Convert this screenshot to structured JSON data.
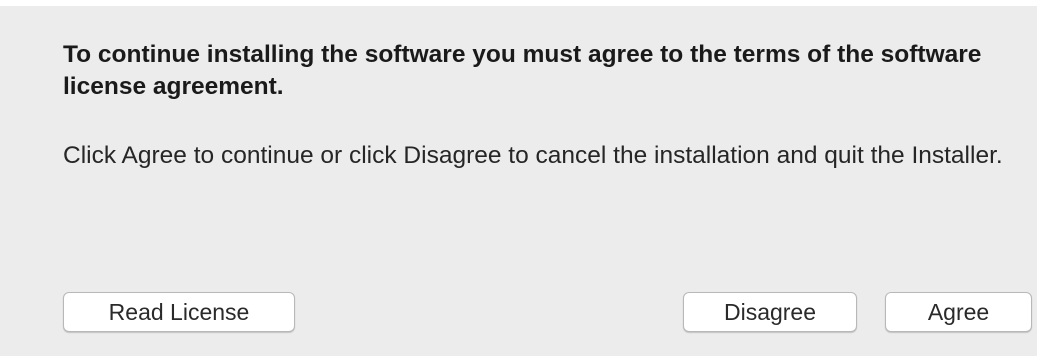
{
  "dialog": {
    "heading": "To continue installing the software you must agree to the terms of the software license agreement.",
    "message": "Click Agree to continue or click Disagree to cancel the installation and quit the Installer."
  },
  "buttons": {
    "read_license": "Read License",
    "disagree": "Disagree",
    "agree": "Agree"
  },
  "colors": {
    "panel_background": "#ececec",
    "button_background": "#ffffff",
    "button_border": "#b8b8b8",
    "text": "#262626"
  }
}
